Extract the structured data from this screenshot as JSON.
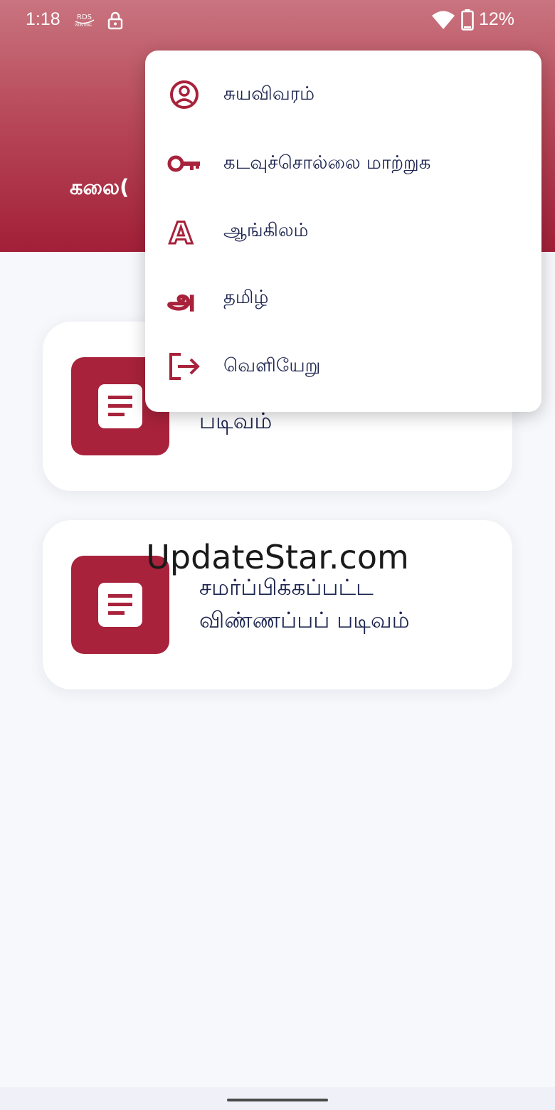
{
  "status_bar": {
    "time": "1:18",
    "battery_percent": "12%",
    "icons": [
      "rds-icon",
      "lock-icon",
      "wifi-icon",
      "battery-icon"
    ]
  },
  "header": {
    "title": "கலை("
  },
  "cards": [
    {
      "label": "படிவம்",
      "icon": "document-icon"
    },
    {
      "label_line1": "சமர்ப்பிக்கப்பட்ட",
      "label_line2": "விண்ணப்பப் படிவம்",
      "icon": "document-icon"
    }
  ],
  "menu": {
    "items": [
      {
        "label": "சுயவிவரம்",
        "icon": "profile-icon"
      },
      {
        "label": "கடவுச்சொல்லை மாற்றுக",
        "icon": "key-icon"
      },
      {
        "label": "ஆங்கிலம்",
        "icon": "english-letter-icon"
      },
      {
        "label": "தமிழ்",
        "icon": "tamil-letter-icon"
      },
      {
        "label": "வெளியேறு",
        "icon": "logout-icon"
      }
    ]
  },
  "watermark": "UpdateStar.com",
  "colors": {
    "accent": "#a8223b",
    "header_top": "#c97480",
    "header_bottom": "#a21f38",
    "text": "#1c2450",
    "background": "#f7f8fb"
  }
}
